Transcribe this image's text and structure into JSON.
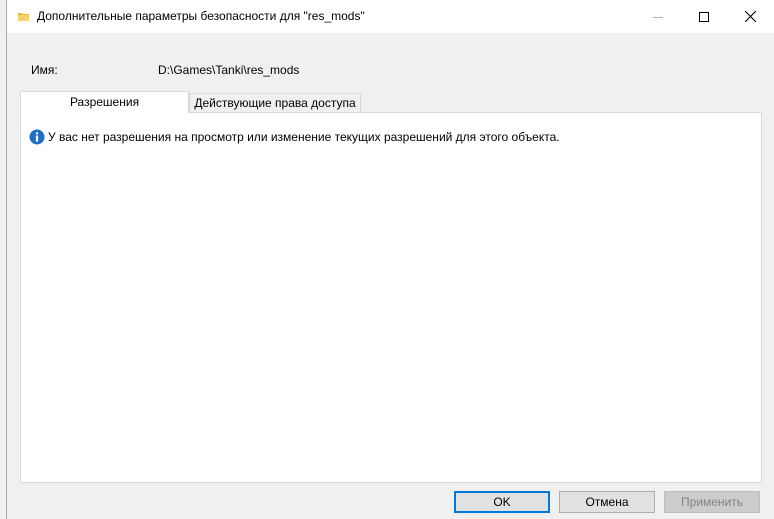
{
  "window": {
    "title": "Дополнительные параметры безопасности  для \"res_mods\""
  },
  "name_row": {
    "label": "Имя:",
    "value": "D:\\Games\\Tanki\\res_mods"
  },
  "tabs": [
    {
      "label": "Разрешения",
      "active": true
    },
    {
      "label": "Действующие права доступа",
      "active": false
    }
  ],
  "message": {
    "icon": "info-icon",
    "text": "У вас нет разрешения на просмотр или изменение текущих разрешений для этого объекта."
  },
  "buttons": {
    "ok": "OK",
    "cancel": "Отмена",
    "apply": "Применить"
  },
  "colors": {
    "accent": "#0078d7",
    "info_icon": "#1e6fc7"
  }
}
